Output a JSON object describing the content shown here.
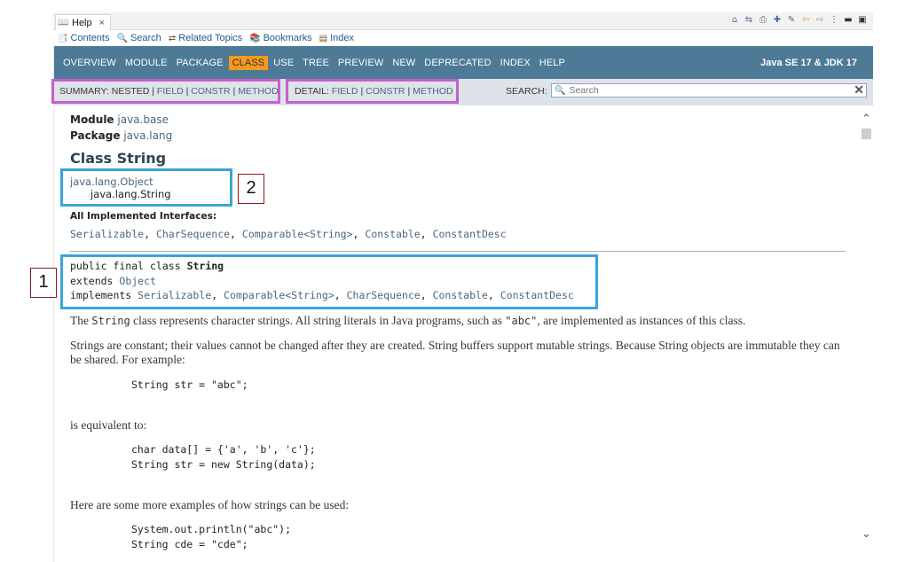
{
  "view": {
    "tab_title": "Help",
    "close_glyph": "×",
    "tab_icon": "help-book-icon",
    "toolbar_icons": [
      "home-icon",
      "show-in-toc-icon",
      "print-icon",
      "bookmark-add-icon",
      "highlight-icon",
      "back-icon",
      "forward-icon",
      "view-menu-icon",
      "minimize-icon",
      "maximize-icon"
    ]
  },
  "help_links": [
    {
      "label": "Contents",
      "icon": "contents-icon"
    },
    {
      "label": "Search",
      "icon": "search-icon"
    },
    {
      "label": "Related Topics",
      "icon": "related-topics-icon"
    },
    {
      "label": "Bookmarks",
      "icon": "bookmarks-icon"
    },
    {
      "label": "Index",
      "icon": "index-icon"
    }
  ],
  "topnav": {
    "items": [
      "OVERVIEW",
      "MODULE",
      "PACKAGE",
      "CLASS",
      "USE",
      "TREE",
      "PREVIEW",
      "NEW",
      "DEPRECATED",
      "INDEX",
      "HELP"
    ],
    "active": "CLASS",
    "about": "Java SE 17 & JDK 17"
  },
  "subnav": {
    "summary_label": "SUMMARY:",
    "summary_nested": "NESTED",
    "summary_field": "FIELD",
    "summary_constr": "CONSTR",
    "summary_method": "METHOD",
    "detail_label": "DETAIL:",
    "detail_field": "FIELD",
    "detail_constr": "CONSTR",
    "detail_method": "METHOD",
    "separator": "|",
    "search_label": "SEARCH:",
    "search_placeholder": "Search"
  },
  "header": {
    "module_label": "Module",
    "module_value": "java.base",
    "package_label": "Package",
    "package_value": "java.lang",
    "title": "Class String"
  },
  "inheritance": {
    "parent": "java.lang.Object",
    "child": "java.lang.String"
  },
  "interfaces": {
    "label": "All Implemented Interfaces:",
    "items": [
      "Serializable",
      "CharSequence",
      "Comparable<String>",
      "Constable",
      "ConstantDesc"
    ]
  },
  "signature": {
    "line1_prefix": "public final class ",
    "line1_name": "String",
    "line2_prefix": "extends ",
    "line2_link": "Object",
    "line3_prefix": "implements ",
    "line3_links": [
      "Serializable",
      "Comparable<String>",
      "CharSequence",
      "Constable",
      "ConstantDesc"
    ]
  },
  "description": {
    "p1_a": "The ",
    "p1_code1": "String",
    "p1_b": " class represents character strings. All string literals in Java programs, such as ",
    "p1_code2": "\"abc\"",
    "p1_c": ", are implemented as instances of this class.",
    "p2": "Strings are constant; their values cannot be changed after they are created. String buffers support mutable strings. Because String objects are immutable they can be shared. For example:",
    "code1": "String str = \"abc\";",
    "p3": "is equivalent to:",
    "code2_line1": "char data[] = {'a', 'b', 'c'};",
    "code2_line2": "String str = new String(data);",
    "p4": "Here are some more examples of how strings can be used:",
    "code3_line1": "System.out.println(\"abc\");",
    "code3_line2": "String cde = \"cde\";"
  },
  "annotations": {
    "callout_1": "1",
    "callout_2": "2",
    "colors": {
      "summary_box": "#c561c8",
      "detail_box": "#c561c8",
      "highlight_box": "#3aa5d8",
      "callout_border": "#8b1a1a"
    }
  }
}
